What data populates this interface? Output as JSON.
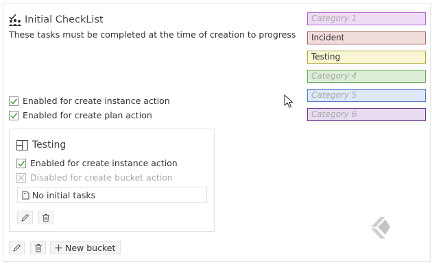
{
  "checklist": {
    "title": "Initial CheckList",
    "subtitle": "These tasks must be completed at the time of creation to progress",
    "options": [
      {
        "label": "Enabled for create instance action",
        "checked": true
      },
      {
        "label": "Enabled for create plan action",
        "checked": true
      }
    ]
  },
  "categories": [
    {
      "label": "Category 1",
      "placeholder": true,
      "fill": "#eedcf6",
      "border": "#b35dc7",
      "text": "#a9a9a9"
    },
    {
      "label": "Incident",
      "placeholder": false,
      "fill": "#f1dcdc",
      "border": "#b06464",
      "text": "#333333"
    },
    {
      "label": "Testing",
      "placeholder": false,
      "fill": "#f9f6d3",
      "border": "#b1a635",
      "text": "#333333"
    },
    {
      "label": "Category 4",
      "placeholder": true,
      "fill": "#dcefd6",
      "border": "#69a85a",
      "text": "#a9a9a9"
    },
    {
      "label": "Category 5",
      "placeholder": true,
      "fill": "#dee8fa",
      "border": "#5a7ac4",
      "text": "#a9a9a9"
    },
    {
      "label": "Category 6",
      "placeholder": true,
      "fill": "#e7dcf2",
      "border": "#6e3c8c",
      "text": "#a9a9a9"
    }
  ],
  "bucket": {
    "title": "Testing",
    "options": [
      {
        "label": "Enabled for create instance action",
        "checked": true,
        "disabled": false
      },
      {
        "label": "Disabled for create bucket action",
        "checked": false,
        "disabled": true
      }
    ],
    "tasks_text": "No initial tasks",
    "icons": {
      "edit": "pencil-icon",
      "delete": "trash-icon"
    }
  },
  "toolbar": {
    "new_bucket_label": "New bucket",
    "icons": {
      "edit": "pencil-icon",
      "delete": "trash-icon",
      "add": "plus-icon"
    }
  },
  "colors": {
    "check_green": "#3f9a3f",
    "disabled_gray": "#a9a9a9",
    "logo_gray": "#d0d0d0"
  }
}
